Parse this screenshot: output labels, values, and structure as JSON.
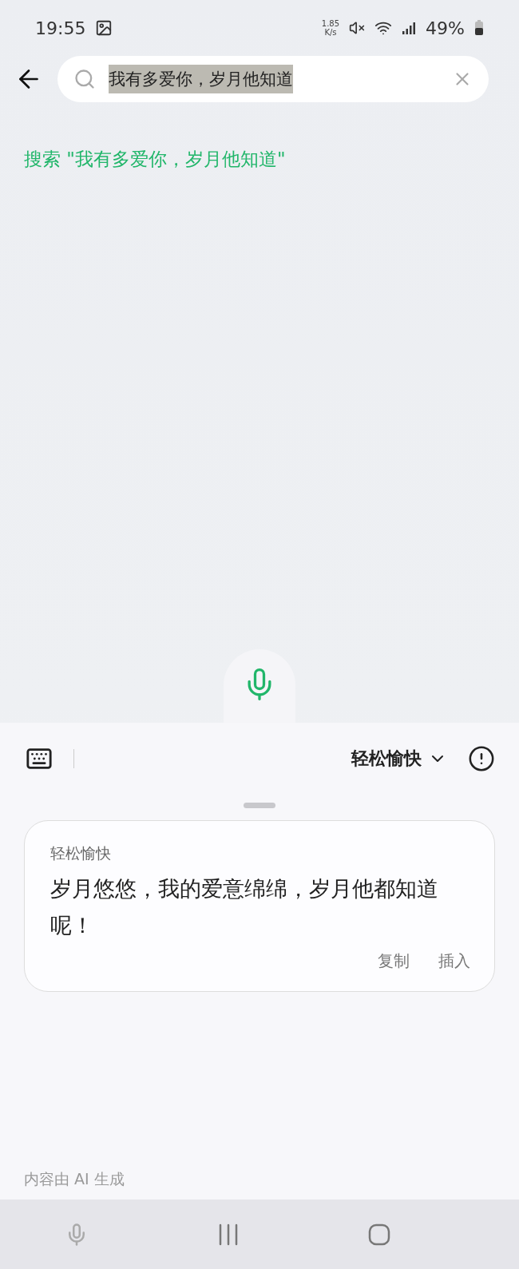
{
  "status_bar": {
    "time": "19:55",
    "net_speed_value": "1.85",
    "net_speed_unit": "K/s",
    "battery": "49%"
  },
  "search": {
    "value": "我有多爱你，岁月他知道",
    "text_selected": true
  },
  "suggestion": "搜索 \"我有多爱你，岁月他知道\"",
  "voice_panel": {
    "style": "轻松愉快",
    "card": {
      "label": "轻松愉快",
      "text": "岁月悠悠，我的爱意绵绵，岁月他都知道呢！",
      "actions": [
        "复制",
        "插入"
      ]
    },
    "footer": "内容由 AI 生成"
  }
}
